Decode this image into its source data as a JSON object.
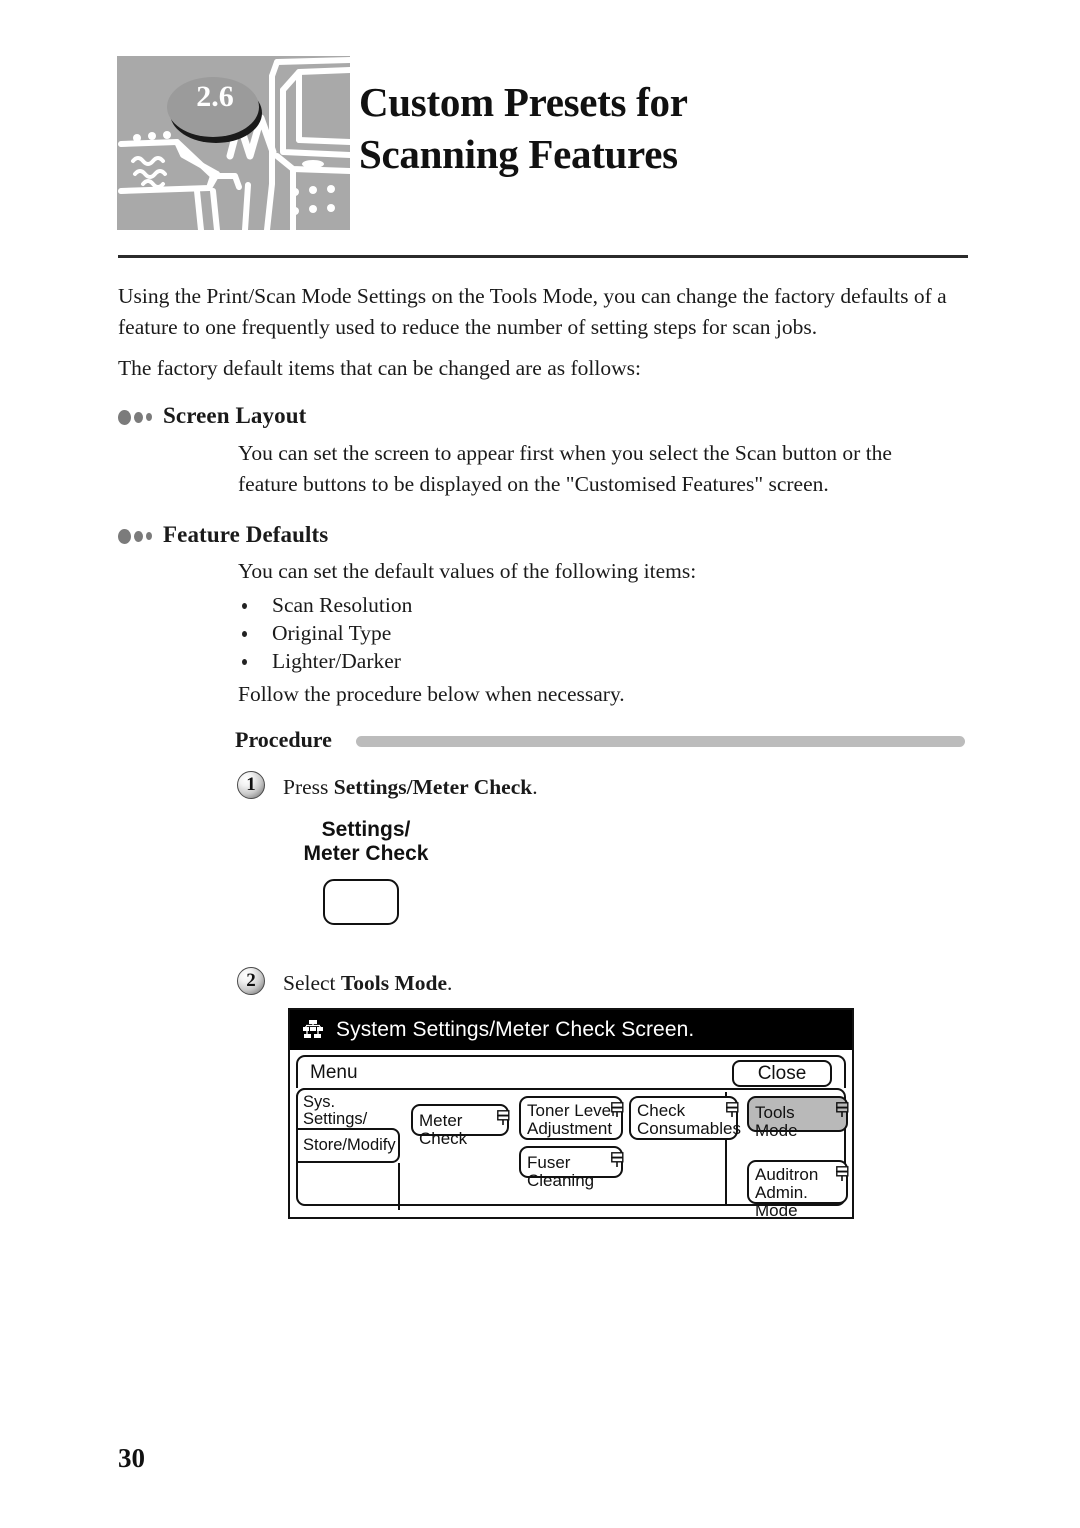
{
  "header": {
    "chapter_number": "2.6",
    "title_line1": "Custom Presets for",
    "title_line2": "Scanning Features",
    "art_icon": "desk-computer-line-art"
  },
  "intro": {
    "paragraph1": "Using the Print/Scan Mode Settings on the Tools Mode, you can change the factory defaults of a feature to one frequently used to reduce the number of setting steps for scan jobs.",
    "paragraph2": "The factory default items that can be changed are as follows:"
  },
  "sections": [
    {
      "heading": "Screen Layout",
      "body": "You can set the screen to appear first when you select the Scan button or the feature buttons to be displayed on the \"Customised Features\" screen."
    },
    {
      "heading": "Feature Defaults",
      "body": "You can set the default values of the following items:",
      "items": [
        "Scan  Resolution",
        "Original  Type",
        "Lighter/Darker"
      ],
      "footer": "Follow the procedure below when necessary."
    }
  ],
  "procedure": {
    "label": "Procedure",
    "steps": [
      {
        "number": "1",
        "text_prefix": "Press ",
        "text_bold": "Settings/Meter Check",
        "text_suffix": "."
      },
      {
        "number": "2",
        "text_prefix": "Select ",
        "text_bold": "Tools Mode",
        "text_suffix": "."
      }
    ]
  },
  "panel_key": {
    "label_line1": "Settings/",
    "label_line2": "Meter Check"
  },
  "ui_screen": {
    "title": "System Settings/Meter Check Screen.",
    "title_icon": "sitemap-icon",
    "menu_label": "Menu",
    "close_label": "Close",
    "tabs": [
      {
        "line1": "Sys. Settings/",
        "line2": "Meter Check",
        "selected": true
      },
      {
        "line1": "Store/Modify",
        "line2": "",
        "selected": false
      }
    ],
    "buttons": [
      {
        "line1": "Meter Check",
        "line2": "",
        "selected": false
      },
      {
        "line1": "Toner Level",
        "line2": "Adjustment",
        "selected": false
      },
      {
        "line1": "Check",
        "line2": "Consumables",
        "selected": false
      },
      {
        "line1": "Fuser Cleaning",
        "line2": "",
        "selected": false
      },
      {
        "line1": "Tools Mode",
        "line2": "",
        "selected": true
      },
      {
        "line1": "Auditron",
        "line2": "Admin. Mode",
        "selected": false
      }
    ]
  },
  "footer": {
    "page_number": "30"
  },
  "colors": {
    "art_background": "#a9a9a9",
    "bullet_gray": "#7b7b7b",
    "procedure_bar": "#bcbcbc",
    "selected_button": "#b9b9b9",
    "titlebar": "#000000"
  }
}
